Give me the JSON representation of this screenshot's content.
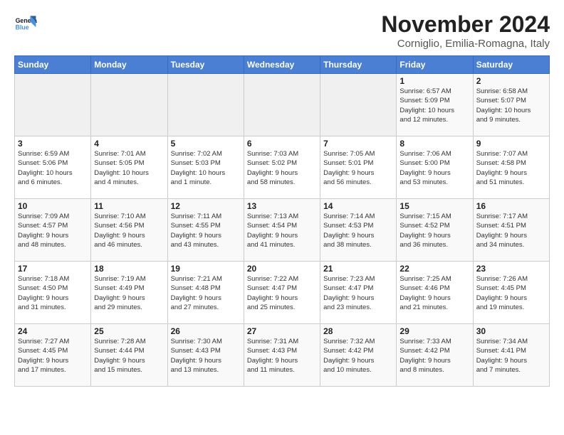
{
  "header": {
    "logo_line1": "General",
    "logo_line2": "Blue",
    "month_year": "November 2024",
    "location": "Corniglio, Emilia-Romagna, Italy"
  },
  "weekdays": [
    "Sunday",
    "Monday",
    "Tuesday",
    "Wednesday",
    "Thursday",
    "Friday",
    "Saturday"
  ],
  "weeks": [
    [
      {
        "day": "",
        "info": ""
      },
      {
        "day": "",
        "info": ""
      },
      {
        "day": "",
        "info": ""
      },
      {
        "day": "",
        "info": ""
      },
      {
        "day": "",
        "info": ""
      },
      {
        "day": "1",
        "info": "Sunrise: 6:57 AM\nSunset: 5:09 PM\nDaylight: 10 hours\nand 12 minutes."
      },
      {
        "day": "2",
        "info": "Sunrise: 6:58 AM\nSunset: 5:07 PM\nDaylight: 10 hours\nand 9 minutes."
      }
    ],
    [
      {
        "day": "3",
        "info": "Sunrise: 6:59 AM\nSunset: 5:06 PM\nDaylight: 10 hours\nand 6 minutes."
      },
      {
        "day": "4",
        "info": "Sunrise: 7:01 AM\nSunset: 5:05 PM\nDaylight: 10 hours\nand 4 minutes."
      },
      {
        "day": "5",
        "info": "Sunrise: 7:02 AM\nSunset: 5:03 PM\nDaylight: 10 hours\nand 1 minute."
      },
      {
        "day": "6",
        "info": "Sunrise: 7:03 AM\nSunset: 5:02 PM\nDaylight: 9 hours\nand 58 minutes."
      },
      {
        "day": "7",
        "info": "Sunrise: 7:05 AM\nSunset: 5:01 PM\nDaylight: 9 hours\nand 56 minutes."
      },
      {
        "day": "8",
        "info": "Sunrise: 7:06 AM\nSunset: 5:00 PM\nDaylight: 9 hours\nand 53 minutes."
      },
      {
        "day": "9",
        "info": "Sunrise: 7:07 AM\nSunset: 4:58 PM\nDaylight: 9 hours\nand 51 minutes."
      }
    ],
    [
      {
        "day": "10",
        "info": "Sunrise: 7:09 AM\nSunset: 4:57 PM\nDaylight: 9 hours\nand 48 minutes."
      },
      {
        "day": "11",
        "info": "Sunrise: 7:10 AM\nSunset: 4:56 PM\nDaylight: 9 hours\nand 46 minutes."
      },
      {
        "day": "12",
        "info": "Sunrise: 7:11 AM\nSunset: 4:55 PM\nDaylight: 9 hours\nand 43 minutes."
      },
      {
        "day": "13",
        "info": "Sunrise: 7:13 AM\nSunset: 4:54 PM\nDaylight: 9 hours\nand 41 minutes."
      },
      {
        "day": "14",
        "info": "Sunrise: 7:14 AM\nSunset: 4:53 PM\nDaylight: 9 hours\nand 38 minutes."
      },
      {
        "day": "15",
        "info": "Sunrise: 7:15 AM\nSunset: 4:52 PM\nDaylight: 9 hours\nand 36 minutes."
      },
      {
        "day": "16",
        "info": "Sunrise: 7:17 AM\nSunset: 4:51 PM\nDaylight: 9 hours\nand 34 minutes."
      }
    ],
    [
      {
        "day": "17",
        "info": "Sunrise: 7:18 AM\nSunset: 4:50 PM\nDaylight: 9 hours\nand 31 minutes."
      },
      {
        "day": "18",
        "info": "Sunrise: 7:19 AM\nSunset: 4:49 PM\nDaylight: 9 hours\nand 29 minutes."
      },
      {
        "day": "19",
        "info": "Sunrise: 7:21 AM\nSunset: 4:48 PM\nDaylight: 9 hours\nand 27 minutes."
      },
      {
        "day": "20",
        "info": "Sunrise: 7:22 AM\nSunset: 4:47 PM\nDaylight: 9 hours\nand 25 minutes."
      },
      {
        "day": "21",
        "info": "Sunrise: 7:23 AM\nSunset: 4:47 PM\nDaylight: 9 hours\nand 23 minutes."
      },
      {
        "day": "22",
        "info": "Sunrise: 7:25 AM\nSunset: 4:46 PM\nDaylight: 9 hours\nand 21 minutes."
      },
      {
        "day": "23",
        "info": "Sunrise: 7:26 AM\nSunset: 4:45 PM\nDaylight: 9 hours\nand 19 minutes."
      }
    ],
    [
      {
        "day": "24",
        "info": "Sunrise: 7:27 AM\nSunset: 4:45 PM\nDaylight: 9 hours\nand 17 minutes."
      },
      {
        "day": "25",
        "info": "Sunrise: 7:28 AM\nSunset: 4:44 PM\nDaylight: 9 hours\nand 15 minutes."
      },
      {
        "day": "26",
        "info": "Sunrise: 7:30 AM\nSunset: 4:43 PM\nDaylight: 9 hours\nand 13 minutes."
      },
      {
        "day": "27",
        "info": "Sunrise: 7:31 AM\nSunset: 4:43 PM\nDaylight: 9 hours\nand 11 minutes."
      },
      {
        "day": "28",
        "info": "Sunrise: 7:32 AM\nSunset: 4:42 PM\nDaylight: 9 hours\nand 10 minutes."
      },
      {
        "day": "29",
        "info": "Sunrise: 7:33 AM\nSunset: 4:42 PM\nDaylight: 9 hours\nand 8 minutes."
      },
      {
        "day": "30",
        "info": "Sunrise: 7:34 AM\nSunset: 4:41 PM\nDaylight: 9 hours\nand 7 minutes."
      }
    ]
  ]
}
